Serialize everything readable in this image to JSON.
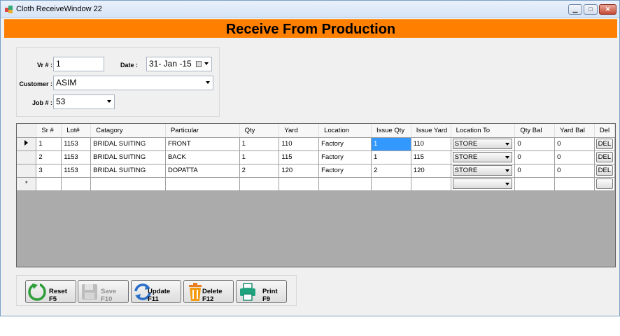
{
  "window": {
    "title": "Cloth ReceiveWindow   22",
    "minimize": "▁",
    "maximize": "□",
    "close": "✕"
  },
  "banner": {
    "title": "Receive From Production"
  },
  "form": {
    "vr_label": "Vr # :",
    "vr_value": "1",
    "date_label": "Date :",
    "date_value": "31- Jan -15",
    "customer_label": "Customer :",
    "customer_value": "ASIM",
    "job_label": "Job # :",
    "job_value": "53"
  },
  "grid": {
    "columns": [
      "Sr #",
      "Lot#",
      "Catagory",
      "Particular",
      "Qty",
      "Yard",
      "Location",
      "Issue Qty",
      "Issue Yard",
      "Location To",
      "Qty Bal",
      "Yard Bal",
      "Del"
    ],
    "rows": [
      {
        "sr": "1",
        "lot": "1153",
        "category": "BRIDAL SUITING",
        "particular": "FRONT",
        "qty": "1",
        "yard": "110",
        "location": "Factory",
        "issue_qty": "1",
        "issue_yard": "110",
        "location_to": "STORE",
        "qty_bal": "0",
        "yard_bal": "0",
        "del": "DEL"
      },
      {
        "sr": "2",
        "lot": "1153",
        "category": "BRIDAL SUITING",
        "particular": "BACK",
        "qty": "1",
        "yard": "115",
        "location": "Factory",
        "issue_qty": "1",
        "issue_yard": "115",
        "location_to": "STORE",
        "qty_bal": "0",
        "yard_bal": "0",
        "del": "DEL"
      },
      {
        "sr": "3",
        "lot": "1153",
        "category": "BRIDAL SUITING",
        "particular": "DOPATTA",
        "qty": "2",
        "yard": "120",
        "location": "Factory",
        "issue_qty": "2",
        "issue_yard": "120",
        "location_to": "STORE",
        "qty_bal": "0",
        "yard_bal": "0",
        "del": "DEL"
      }
    ],
    "new_row_marker": "*"
  },
  "toolbar": {
    "reset": "Reset F5",
    "save": "Save F10",
    "update": "Update F11",
    "delete": "Delete F12",
    "print": "Print F9"
  },
  "colors": {
    "banner": "#ff8000",
    "selection": "#3399ff",
    "grid_bg": "#ababab"
  }
}
